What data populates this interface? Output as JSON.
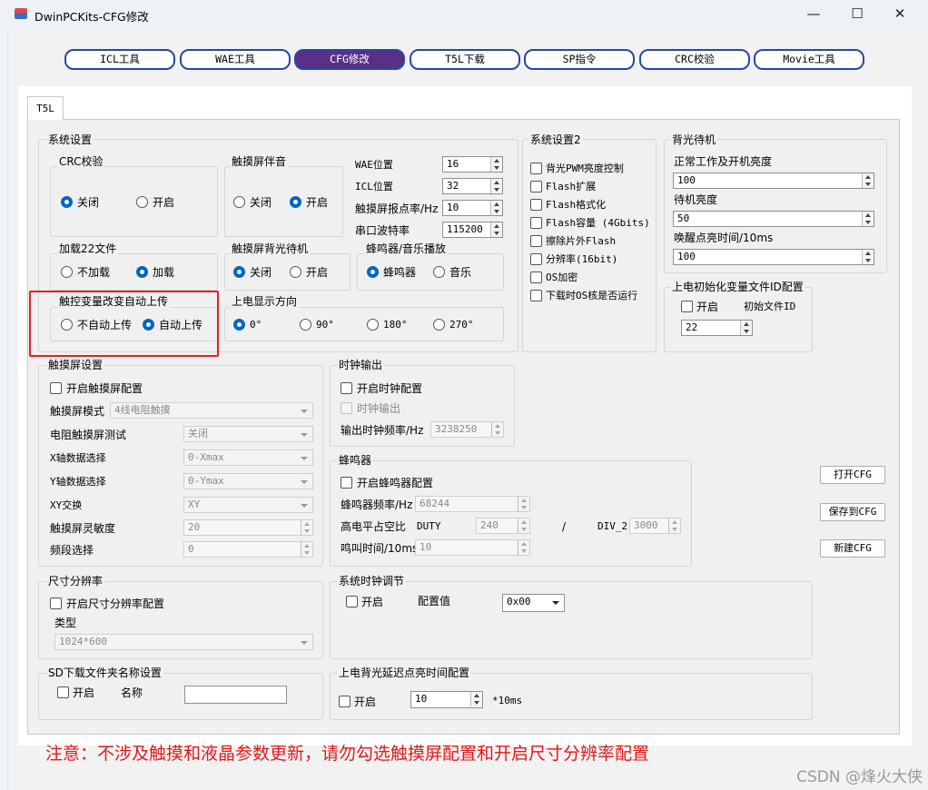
{
  "window": {
    "title": "DwinPCKits-CFG修改",
    "minimize_glyph": "—",
    "maximize_glyph": "☐",
    "close_glyph": "✕"
  },
  "toolbar_tabs": [
    "ICL工具",
    "WAE工具",
    "CFG修改",
    "T5L下载",
    "SP指令",
    "CRC校验",
    "Movie工具"
  ],
  "active_tab": "CFG修改",
  "sub_tab": "T5L",
  "sys": {
    "title": "系统设置",
    "crc": {
      "title": "CRC校验",
      "off": "关闭",
      "on": "开启",
      "selected": "关闭"
    },
    "touch_sound": {
      "title": "触摸屏伴音",
      "off": "关闭",
      "on": "开启",
      "selected": "开启"
    },
    "wae_pos": {
      "label": "WAE位置",
      "value": "16"
    },
    "icl_pos": {
      "label": "ICL位置",
      "value": "32"
    },
    "report_rate": {
      "label": "触摸屏报点率/Hz",
      "value": "10"
    },
    "baud": {
      "label": "串口波特率",
      "value": "115200"
    },
    "load22": {
      "title": "加载22文件",
      "off": "不加载",
      "on": "加载",
      "selected": "加载"
    },
    "backlight_standby": {
      "title": "触摸屏背光待机",
      "off": "关闭",
      "on": "开启",
      "selected": "关闭"
    },
    "buzzer_music": {
      "title": "蜂鸣器/音乐播放",
      "buzzer": "蜂鸣器",
      "music": "音乐",
      "selected": "蜂鸣器"
    },
    "auto_upload": {
      "title": "触控变量改变自动上传",
      "off": "不自动上传",
      "on": "自动上传",
      "selected": "自动上传"
    },
    "orientation": {
      "title": "上电显示方向",
      "options": [
        "0°",
        "90°",
        "180°",
        "270°"
      ],
      "selected": "0°"
    }
  },
  "sys2": {
    "title": "系统设置2",
    "items": [
      "背光PWM亮度控制",
      "Flash扩展",
      "Flash格式化",
      "Flash容量 (4Gbits)",
      "擦除片外Flash",
      "分辨率(16bit)",
      "OS加密",
      "下载时OS核是否运行"
    ]
  },
  "backlight": {
    "title": "背光待机",
    "normal_label": "正常工作及开机亮度",
    "normal_value": "100",
    "standby_label": "待机亮度",
    "standby_value": "50",
    "wake_label": "唤醒点亮时间/10ms",
    "wake_value": "100"
  },
  "init_var": {
    "title": "上电初始化变量文件ID配置",
    "enable": "开启",
    "file_id_label": "初始文件ID",
    "file_id": "22"
  },
  "touch": {
    "title": "触摸屏设置",
    "enable": "开启触摸屏配置",
    "mode_label": "触摸屏模式",
    "mode_value": "4线电阻触摸",
    "resist_test_label": "电阻触摸屏测试",
    "resist_test_value": "关闭",
    "x_label": "X轴数据选择",
    "x_value": "0-Xmax",
    "y_label": "Y轴数据选择",
    "y_value": "0-Ymax",
    "xy_label": "XY交换",
    "xy_value": "XY",
    "sens_label": "触摸屏灵敏度",
    "sens_value": "20",
    "band_label": "频段选择",
    "band_value": "0"
  },
  "clock": {
    "title": "时钟输出",
    "enable": "开启时钟配置",
    "output": "时钟输出",
    "freq_label": "输出时钟频率/Hz",
    "freq_value": "3238250"
  },
  "buzzer": {
    "title": "蜂鸣器",
    "enable": "开启蜂鸣器配置",
    "freq_label": "蜂鸣器频率/Hz",
    "freq_value": "68244",
    "duty_label": "高电平占空比",
    "duty_tag": "DUTY",
    "duty_value": "240",
    "slash": "/",
    "div_tag": "DIV_2",
    "div_value": "3000",
    "time_label": "鸣叫时间/10ms",
    "time_value": "10"
  },
  "buttons": {
    "open": "打开CFG",
    "save": "保存到CFG",
    "new": "新建CFG"
  },
  "resolution": {
    "title": "尺寸分辨率",
    "enable": "开启尺寸分辨率配置",
    "type_label": "类型",
    "type_value": "1024*600"
  },
  "sysclk": {
    "title": "系统时钟调节",
    "enable": "开启",
    "config_label": "配置值",
    "config_value": "0x00"
  },
  "sd": {
    "title": "SD下载文件夹名称设置",
    "enable": "开启",
    "name_label": "名称",
    "name_value": ""
  },
  "delay": {
    "title": "上电背光延迟点亮时间配置",
    "enable": "开启",
    "value": "10",
    "unit": "*10ms"
  },
  "notice": "注意：不涉及触摸和液晶参数更新，请勿勾选触摸屏配置和开启尺寸分辨率配置",
  "watermark": "CSDN @烽火大侠"
}
